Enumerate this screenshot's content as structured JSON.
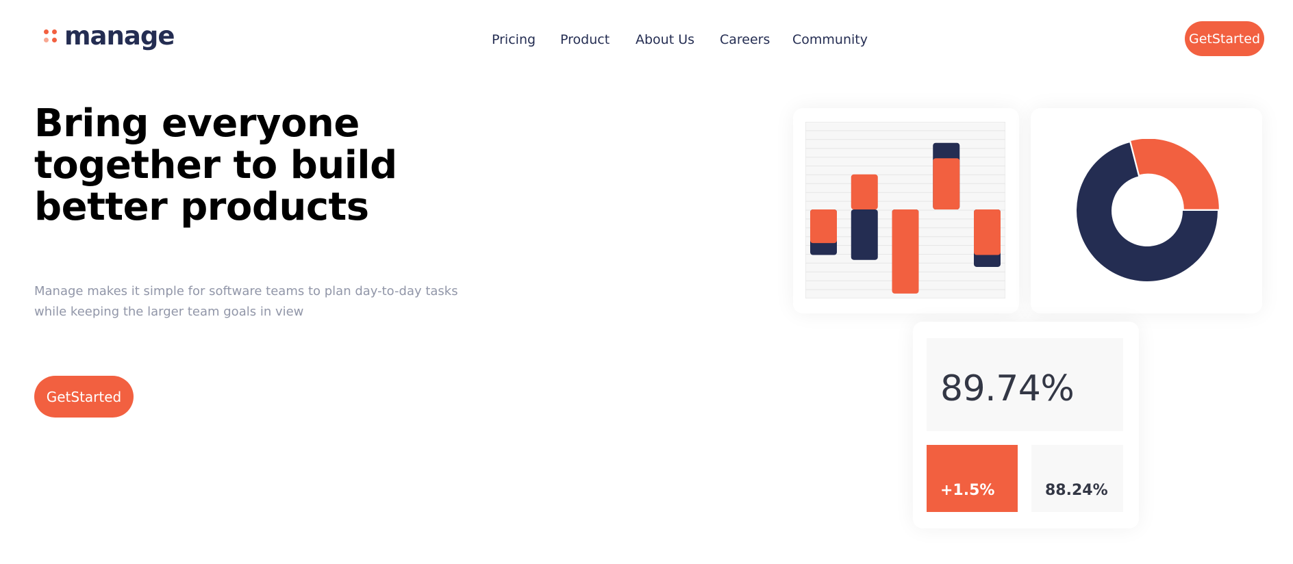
{
  "brand": {
    "name": "manage",
    "colors": {
      "accent": "#f26040",
      "accent_light": "#f8a792",
      "navy": "#242d52"
    }
  },
  "nav": {
    "items": [
      {
        "label": "Pricing"
      },
      {
        "label": "Product"
      },
      {
        "label": "About Us"
      },
      {
        "label": "Careers"
      },
      {
        "label": "Community"
      }
    ],
    "cta_label": "GetStarted"
  },
  "hero": {
    "title": "Bring everyone together to build better products",
    "subtitle": "Manage makes it simple for software teams to plan day-to-day tasks while keeping the larger team goals in view",
    "cta_label": "GetStarted"
  },
  "stats": {
    "main_value": "89.74%",
    "change_value": "+1.5%",
    "secondary_value": "88.24%"
  },
  "chart_data": [
    {
      "type": "bar",
      "series": [
        {
          "values": [
            -6.5,
            -7.2,
            -4.8,
            9.5,
            -8.2
          ],
          "color": "#242d52"
        },
        {
          "values": [
            -4.8,
            5.0,
            -12.0,
            7.3,
            -6.5
          ],
          "color": "#f26040"
        }
      ],
      "ylim": [
        -12.5,
        12.5
      ],
      "grid": true
    },
    {
      "type": "pie",
      "style": "donut",
      "values": [
        71,
        29
      ],
      "colors": [
        "#242d52",
        "#f26040"
      ]
    }
  ]
}
